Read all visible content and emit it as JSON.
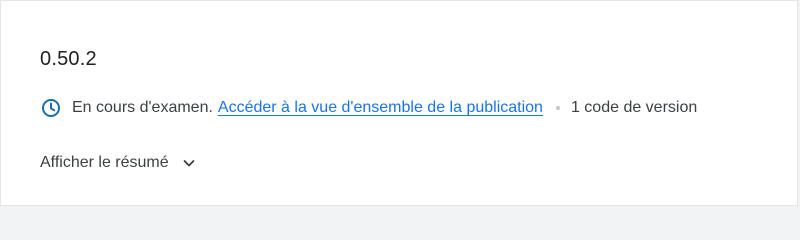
{
  "release": {
    "version_name": "0.50.2"
  },
  "status": {
    "icon": "clock-icon",
    "text": "En cours d'examen.",
    "link_text": "Accéder à la vue d'ensemble de la publication",
    "version_count": "1 code de version"
  },
  "summary": {
    "toggle_label": "Afficher le résumé",
    "icon": "chevron-down-icon"
  },
  "colors": {
    "link": "#1a73e8",
    "status_icon": "#1a6fa8",
    "text": "#3c4043",
    "title": "#202124"
  }
}
